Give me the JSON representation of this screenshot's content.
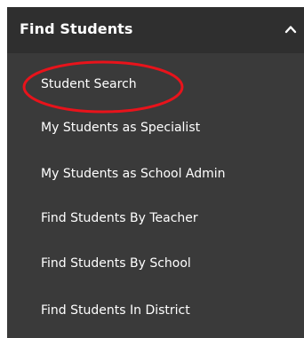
{
  "panel": {
    "title": "Find Students",
    "header_bg": "#2f2f2f",
    "body_bg": "#3a3a3a",
    "collapse_icon": "chevron-up-icon"
  },
  "menu": {
    "items": [
      {
        "label": "Student Search",
        "highlighted": true
      },
      {
        "label": "My Students as Specialist"
      },
      {
        "label": "My Students as School Admin"
      },
      {
        "label": "Find Students By Teacher"
      },
      {
        "label": "Find Students By School"
      },
      {
        "label": "Find Students In District"
      }
    ]
  },
  "annotation": {
    "shape": "ellipse",
    "color": "#e8131b"
  }
}
